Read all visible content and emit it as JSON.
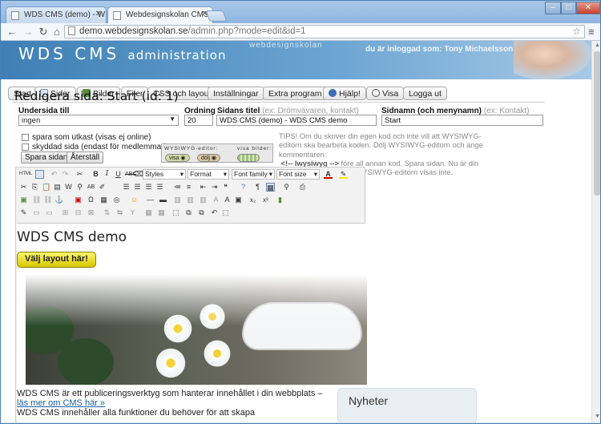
{
  "browser": {
    "tabs": [
      {
        "title": "WDS CMS (demo) - WDS",
        "active": false
      },
      {
        "title": "Webdesignskolan CMS - a",
        "active": true
      }
    ],
    "url_domain": "demo.webdesignskolan.se",
    "url_path": "/admin.php?mode=edit&id=1"
  },
  "cms": {
    "logo": "WDS CMS",
    "logo_sub": "administration",
    "watermark": "webdesignskolan",
    "user_text": "du är inloggad som: Tony Michaelsson",
    "menu": [
      {
        "label": "Start",
        "icon": ""
      },
      {
        "label": "Sidor",
        "icon": "page-icon"
      },
      {
        "label": "Bilder",
        "icon": "image-icon"
      },
      {
        "label": "Filer",
        "icon": ""
      },
      {
        "label": "CSS och layout",
        "icon": ""
      },
      {
        "label": "Inställningar",
        "icon": ""
      },
      {
        "label": "Extra program",
        "icon": ""
      },
      {
        "label": "Hjälp!",
        "icon": "help-icon"
      },
      {
        "label": "Visa",
        "icon": "search-icon"
      },
      {
        "label": "Logga ut",
        "icon": ""
      }
    ]
  },
  "form": {
    "heading": "Redigera sida: Start (id: 1)",
    "undersida_label": "Undersida till",
    "undersida_value": "ingen",
    "ordning_label": "Ordning",
    "ordning_value": "20",
    "sidans_titel_label": "Sidans titel",
    "sidans_titel_hint": "(ex: Drömvävaren, kontakt)",
    "sidans_titel_value": "WDS CMS (demo)  - WDS CMS demo",
    "sidnamn_label": "Sidnamn (och menynamn)",
    "sidnamn_hint": "(ex: Kontakt)",
    "sidnamn_value": "Start",
    "chk_utkast": "spara som utkast (visas ej online)",
    "chk_skyddad": "skyddad sida (endast för medlemmar)",
    "save_button": "Spara sidan!",
    "reset_button": "Återställ",
    "wysiwyg_label": "WYSIWYG-editor:",
    "wysiwyg_show": "visa",
    "wysiwyg_hide": "dölj",
    "visa_bilder_label": "visa bilder:",
    "tips": "TIPS! Om du skriver din egen kod och inte vill att WYSIWYG-editorn ska bearbeta koden. Dölj WYSIWYG-editorn och ange kommentaren:",
    "tips_code": "<!-- lwysiwyg -->",
    "tips_rest": "före all annan kod. Spara sidan. Nu är din egen kod skyddad och WYSIWYG-editorn visas inte."
  },
  "editor": {
    "styles": "Styles",
    "format": "Format",
    "font_family": "Font family",
    "font_size": "Font size",
    "content_title": "WDS CMS demo",
    "layout_button": "Välj layout här!",
    "desc_text": "WDS CMS är ett publiceringsverktyg som hanterar innehållet i din webbplats –",
    "desc_link": "läs mer om CMS här »",
    "desc_more": "WDS CMS innehåller alla funktioner du behöver för att skapa",
    "sidebar_title": "Nyheter"
  }
}
